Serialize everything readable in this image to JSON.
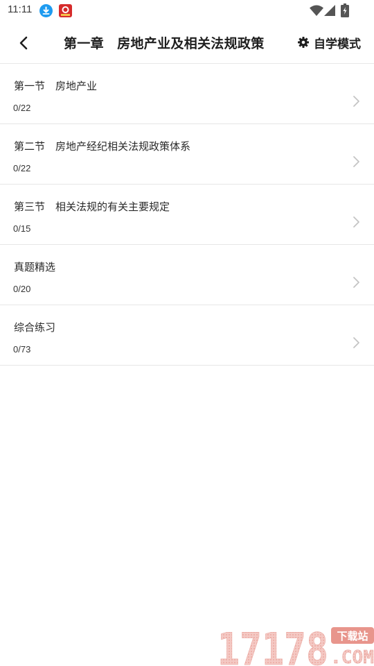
{
  "status_bar": {
    "time": "11:11",
    "icons": [
      "download-icon",
      "app-notification-icon",
      "wifi-icon",
      "signal-icon",
      "battery-charging-icon"
    ]
  },
  "header": {
    "back_icon": "chevron-left-icon",
    "title": "第一章　房地产业及相关法规政策",
    "mode_icon": "gear-icon",
    "mode_label": "自学模式"
  },
  "sections": [
    {
      "title": "第一节　房地产业",
      "progress": "0/22"
    },
    {
      "title": "第二节　房地产经纪相关法规政策体系",
      "progress": "0/22"
    },
    {
      "title": "第三节　相关法规的有关主要规定",
      "progress": "0/15"
    },
    {
      "title": "真题精选",
      "progress": "0/20"
    },
    {
      "title": "综合练习",
      "progress": "0/73"
    }
  ],
  "watermark": {
    "number": "17178",
    "suffix": ".COM",
    "badge": "下载站"
  },
  "colors": {
    "title_text": "#1e1e1e",
    "body_text": "#2a2a2a",
    "divider": "#e6e6e6",
    "chevron": "#c4c4c4",
    "download_badge": "#1e9bf0",
    "app_badge": "#d62b2b"
  }
}
